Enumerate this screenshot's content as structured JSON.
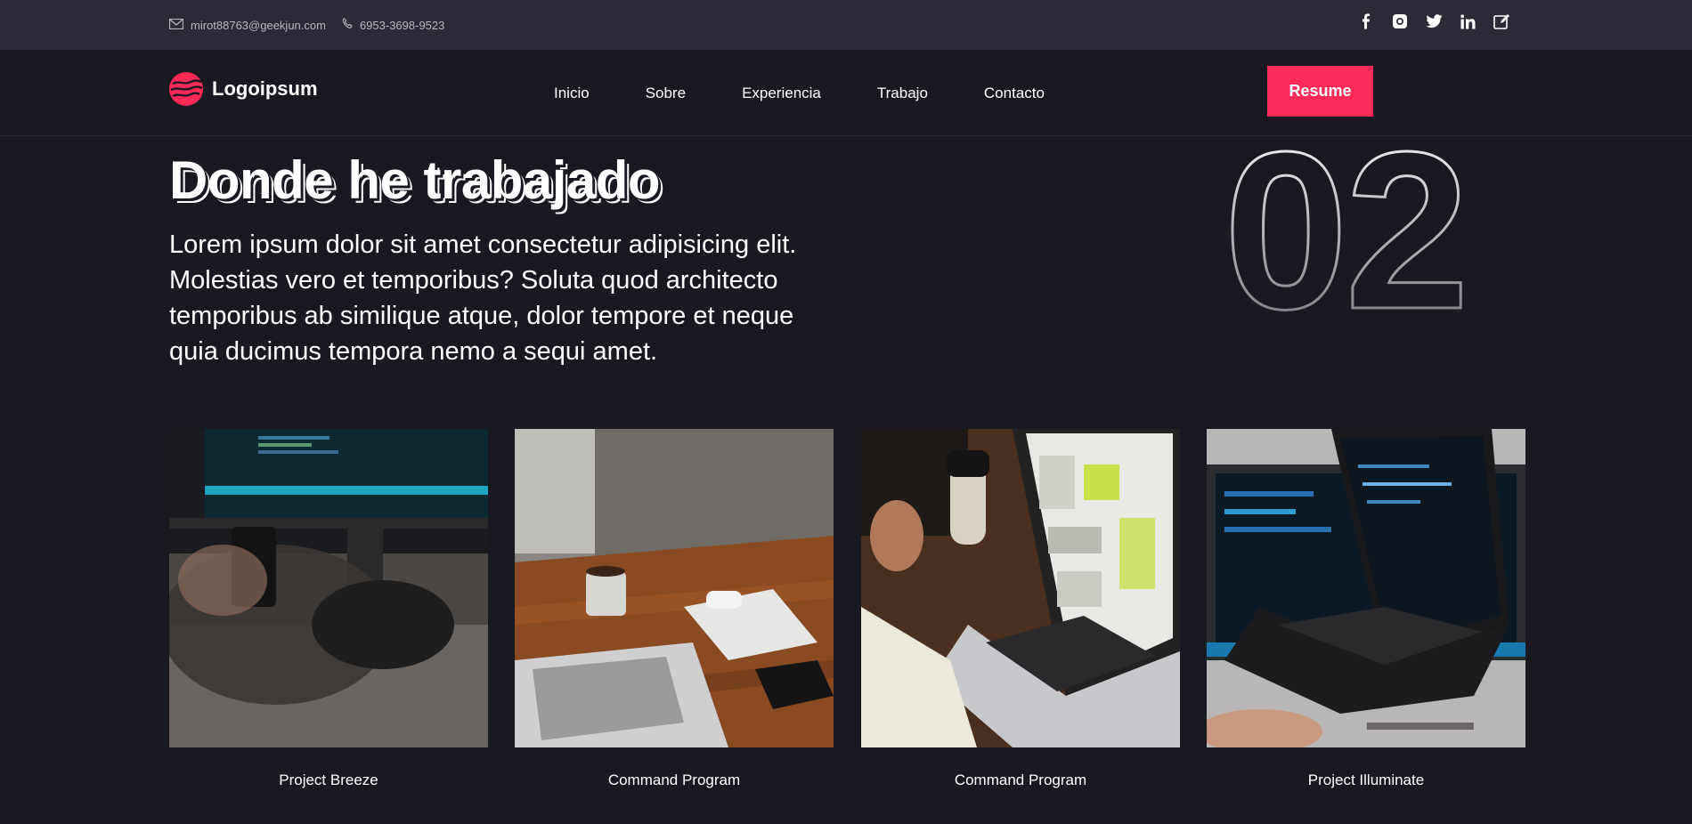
{
  "topbar": {
    "email": "mirot88763@geekjun.com",
    "phone": "6953-3698-9523",
    "social": [
      "facebook-icon",
      "instagram-icon",
      "twitter-icon",
      "linkedin-icon",
      "edit-icon"
    ]
  },
  "nav": {
    "brand": "Logoipsum",
    "items": [
      "Inicio",
      "Sobre",
      "Experiencia",
      "Trabajo",
      "Contacto"
    ],
    "resume_label": "Resume"
  },
  "section": {
    "number": "02",
    "title": "Donde he trabajado",
    "lead": "Lorem ipsum dolor sit amet consectetur adipisicing elit. Molestias vero et temporibus? Soluta quod architecto temporibus ab similique atque, dolor tempore et neque quia ducimus tempora nemo a sequi amet."
  },
  "projects": [
    {
      "caption": "Project Breeze"
    },
    {
      "caption": "Command Program"
    },
    {
      "caption": "Command Program"
    },
    {
      "caption": "Project Illuminate"
    }
  ],
  "colors": {
    "accent": "#ff2a57",
    "background": "#191922",
    "topbar": "#2b2b38"
  }
}
